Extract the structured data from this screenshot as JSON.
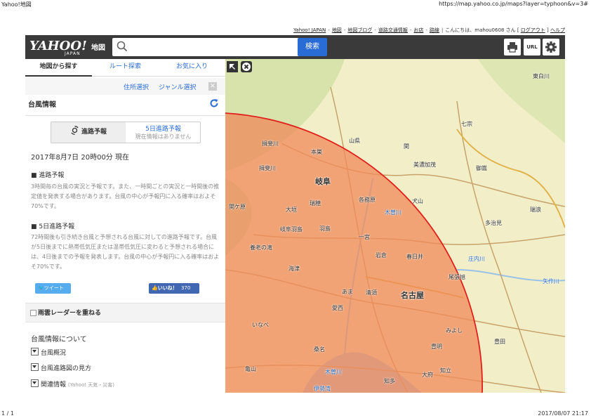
{
  "print": {
    "title": "Yahoo!地図",
    "url": "https://map.yahoo.co.jp/maps?layer=typhoon&v=3#",
    "page": "1 / 1",
    "date": "2017/08/07 21:17"
  },
  "toplinks": {
    "items": [
      "Yahoo! JAPAN",
      "地図",
      "地図ブログ",
      "道路交通情報",
      "お店",
      "路線"
    ],
    "greeting": "こんにちは、mahou0608 さん [",
    "logout": "ログアウト",
    "close_bracket": "]",
    "help": "ヘルプ"
  },
  "header": {
    "logo_text": "YAHOO!",
    "logo_sub": "JAPAN",
    "logo_chizu": "地図",
    "search_value": "",
    "search_button": "検索",
    "url_button": "URL"
  },
  "sidebar": {
    "tabs": [
      "地図から探す",
      "ルート探索",
      "お気に入り"
    ],
    "subnav": {
      "address": "住所選択",
      "genre": "ジャンル選択"
    },
    "section_title": "台風情報",
    "segment": {
      "a": "進路予報",
      "b_title": "5日進路予報",
      "b_sub": "現在情報はありません"
    },
    "datetime": "2017年8月7日 20時00分 現在",
    "block1": {
      "heading": "■ 進路予報",
      "text": "3時間毎の台風の実況と予報です。また、一時間ごとの実況と一時間後の推定値を発表する場合があります。台風の中心が予報円に入る確率はおよそ70%です。"
    },
    "block2": {
      "heading": "■ 5日進路予報",
      "text": "72時間後も引き続き台風と予想される台風に対しての進路予報です。台風が5日後までに熱帯低気圧または温帯低気圧に変わると予想される場合には、4日後までの予報を発表します。台風の中心が予報円に入る確率はおよそ70%です。"
    },
    "tweet": "ツイート",
    "like": "いいね！",
    "like_count": "370",
    "radar": "雨雲レーダーを重ねる",
    "about_title": "台風情報について",
    "about_items": [
      "台風概況",
      "台風進路図の見方",
      "関連情報"
    ],
    "about_sub": "(Yahoo! 天気・災害)"
  },
  "map": {
    "labels": [
      {
        "t": "東白川",
        "c": "",
        "k": ""
      },
      {
        "t": "七宗",
        "c": "",
        "k": ""
      },
      {
        "t": "揖斐川",
        "c": "",
        "k": ""
      },
      {
        "t": "本巣",
        "c": "",
        "k": ""
      },
      {
        "t": "山県",
        "c": "",
        "k": ""
      },
      {
        "t": "関",
        "c": "",
        "k": ""
      },
      {
        "t": "美濃加茂",
        "c": "",
        "k": ""
      },
      {
        "t": "御嵩",
        "c": "",
        "k": ""
      },
      {
        "t": "揖斐川",
        "c": "",
        "k": ""
      },
      {
        "t": "岐阜",
        "c": "",
        "k": "big"
      },
      {
        "t": "各務原",
        "c": "",
        "k": ""
      },
      {
        "t": "犬山",
        "c": "",
        "k": ""
      },
      {
        "t": "関ケ原",
        "c": "",
        "k": ""
      },
      {
        "t": "大垣",
        "c": "",
        "k": ""
      },
      {
        "t": "瑞穂",
        "c": "",
        "k": ""
      },
      {
        "t": "木曽川",
        "c": "blue",
        "k": ""
      },
      {
        "t": "瑞浪",
        "c": "",
        "k": ""
      },
      {
        "t": "多治見",
        "c": "",
        "k": ""
      },
      {
        "t": "岐阜羽島",
        "c": "",
        "k": ""
      },
      {
        "t": "羽島",
        "c": "",
        "k": ""
      },
      {
        "t": "一宮",
        "c": "",
        "k": ""
      },
      {
        "t": "養老の滝",
        "c": "",
        "k": ""
      },
      {
        "t": "岩倉",
        "c": "",
        "k": ""
      },
      {
        "t": "春日井",
        "c": "",
        "k": ""
      },
      {
        "t": "庄内川",
        "c": "blue",
        "k": ""
      },
      {
        "t": "海津",
        "c": "",
        "k": ""
      },
      {
        "t": "尾張旭",
        "c": "",
        "k": ""
      },
      {
        "t": "矢作川",
        "c": "blue",
        "k": ""
      },
      {
        "t": "あま",
        "c": "",
        "k": ""
      },
      {
        "t": "清須",
        "c": "",
        "k": ""
      },
      {
        "t": "名古屋",
        "c": "",
        "k": "big"
      },
      {
        "t": "愛西",
        "c": "",
        "k": ""
      },
      {
        "t": "いなべ",
        "c": "",
        "k": ""
      },
      {
        "t": "みよし",
        "c": "",
        "k": ""
      },
      {
        "t": "豊田",
        "c": "",
        "k": ""
      },
      {
        "t": "桑名",
        "c": "",
        "k": ""
      },
      {
        "t": "豊明",
        "c": "",
        "k": ""
      },
      {
        "t": "亀山",
        "c": "",
        "k": ""
      },
      {
        "t": "木曽川",
        "c": "blue",
        "k": ""
      },
      {
        "t": "知立",
        "c": "",
        "k": ""
      },
      {
        "t": "知多",
        "c": "",
        "k": ""
      },
      {
        "t": "大府",
        "c": "",
        "k": ""
      },
      {
        "t": "伊勢湾",
        "c": "blue",
        "k": ""
      }
    ]
  },
  "colors": {
    "accent": "#2a6cd6",
    "header_bg": "#3a3a3a",
    "forecast_circle_fill": "#f08a5a",
    "forecast_circle_stroke": "#e0201c"
  }
}
